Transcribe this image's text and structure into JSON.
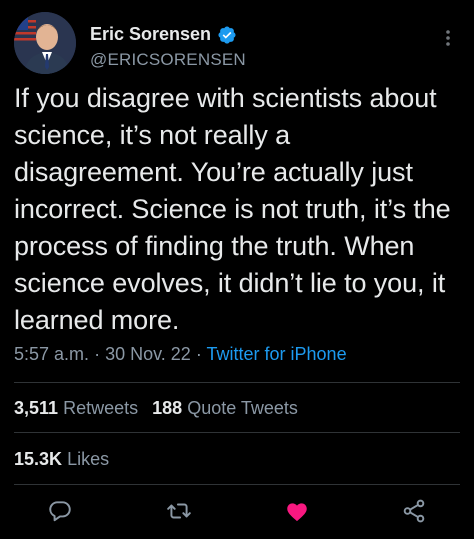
{
  "user": {
    "name": "Eric Sorensen",
    "handle": "@ERICSORENSEN"
  },
  "tweet": {
    "text": "If you disagree with scientists about science, it’s not really a disagreement. You’re actually just incorrect. Science is not truth, it’s the process of finding the truth. When science evolves, it didn’t lie to you, it learned more.",
    "time": "5:57 a.m.",
    "separator": "·",
    "date": "30 Nov. 22",
    "source": "Twitter for iPhone"
  },
  "stats": {
    "retweets_count": "3,511",
    "retweets_label": "Retweets",
    "quotes_count": "188",
    "quotes_label": "Quote Tweets",
    "likes_count": "15.3K",
    "likes_label": "Likes"
  },
  "colors": {
    "background": "#000000",
    "text": "#e7e9ea",
    "muted": "#8b98a5",
    "accent": "#1d9bf0",
    "like": "#f91880"
  },
  "icons": [
    "verified-badge-icon",
    "more-options-icon",
    "reply-icon",
    "retweet-icon",
    "like-icon",
    "share-icon"
  ]
}
